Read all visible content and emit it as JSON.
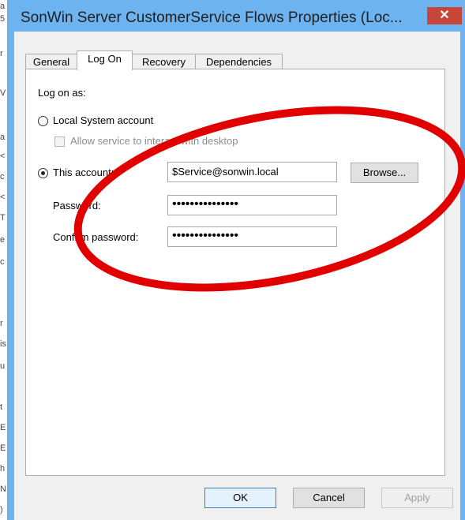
{
  "window": {
    "title": "SonWin Server CustomerService Flows Properties (Loc...",
    "close_glyph": "✕"
  },
  "tabs": [
    {
      "label": "General",
      "active": false
    },
    {
      "label": "Log On",
      "active": true
    },
    {
      "label": "Recovery",
      "active": false
    },
    {
      "label": "Dependencies",
      "active": false
    }
  ],
  "logon": {
    "section_label": "Log on as:",
    "local_system_label": "Local System account",
    "local_system_selected": false,
    "allow_interact_label": "Allow service to interact with desktop",
    "allow_interact_checked": false,
    "this_account_label": "This account:",
    "this_account_selected": true,
    "account_value": "$Service@sonwin.local",
    "browse_label": "Browse...",
    "password_label": "Password:",
    "password_value": "•••••••••••••••",
    "confirm_label": "Confirm password:",
    "confirm_value": "•••••••••••••••"
  },
  "buttons": {
    "ok": "OK",
    "cancel": "Cancel",
    "apply": "Apply"
  },
  "annotation": {
    "color": "#e10000"
  },
  "background_window": {
    "letters": [
      "a",
      "5",
      "r",
      "V",
      "a",
      "<",
      "c",
      "<",
      "T",
      "e",
      "c",
      "r",
      "is",
      "u",
      "t",
      "E",
      "E",
      "h",
      "N",
      ")"
    ]
  }
}
